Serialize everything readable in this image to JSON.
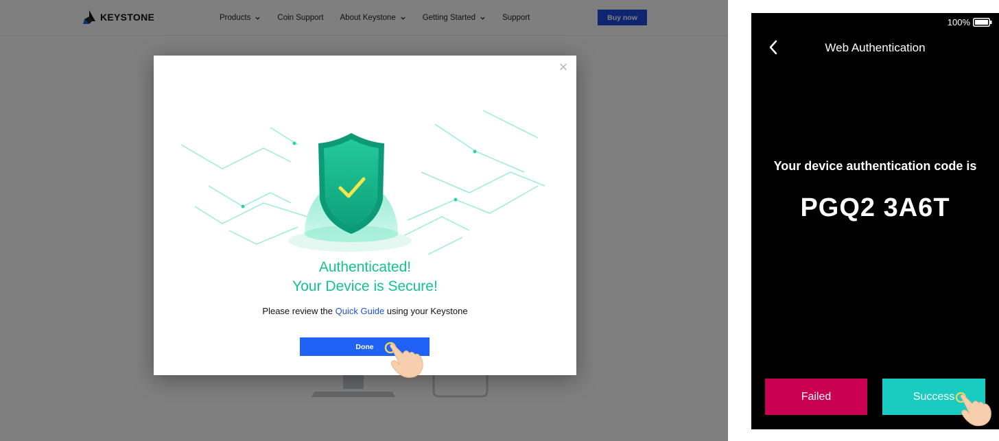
{
  "website": {
    "brand": "KEYSTONE",
    "nav": [
      {
        "label": "Products",
        "dropdown": true
      },
      {
        "label": "Coin Support",
        "dropdown": false
      },
      {
        "label": "About Keystone",
        "dropdown": true
      },
      {
        "label": "Getting Started",
        "dropdown": true
      },
      {
        "label": "Support",
        "dropdown": false
      }
    ],
    "buy_label": "Buy now",
    "modal": {
      "title_line1": "Authenticated!",
      "title_line2": "Your Device is Secure!",
      "desc_prefix": "Please review the ",
      "link_text": "Quick Guide",
      "desc_suffix": " using your Keystone",
      "done_label": "Done",
      "close_glyph": "×"
    }
  },
  "device": {
    "battery": "100%",
    "title": "Web Authentication",
    "auth_label": "Your device authentication code is",
    "auth_code": "PGQ2 3A6T",
    "failed_label": "Failed",
    "success_label": "Success"
  },
  "colors": {
    "accent_green": "#13c28f",
    "link_blue": "#1f50d8",
    "done_blue": "#1f62f5",
    "buy_blue": "#1f4ae0",
    "failed_red": "#c8004f",
    "success_teal": "#19cbc0"
  },
  "icons": {
    "logo": "keystone-logo",
    "dropdown": "chevron-down-icon",
    "close": "close-icon",
    "shield": "shield-check-icon",
    "pointer": "hand-pointer-icon",
    "back": "chevron-left-icon",
    "battery": "battery-icon"
  }
}
